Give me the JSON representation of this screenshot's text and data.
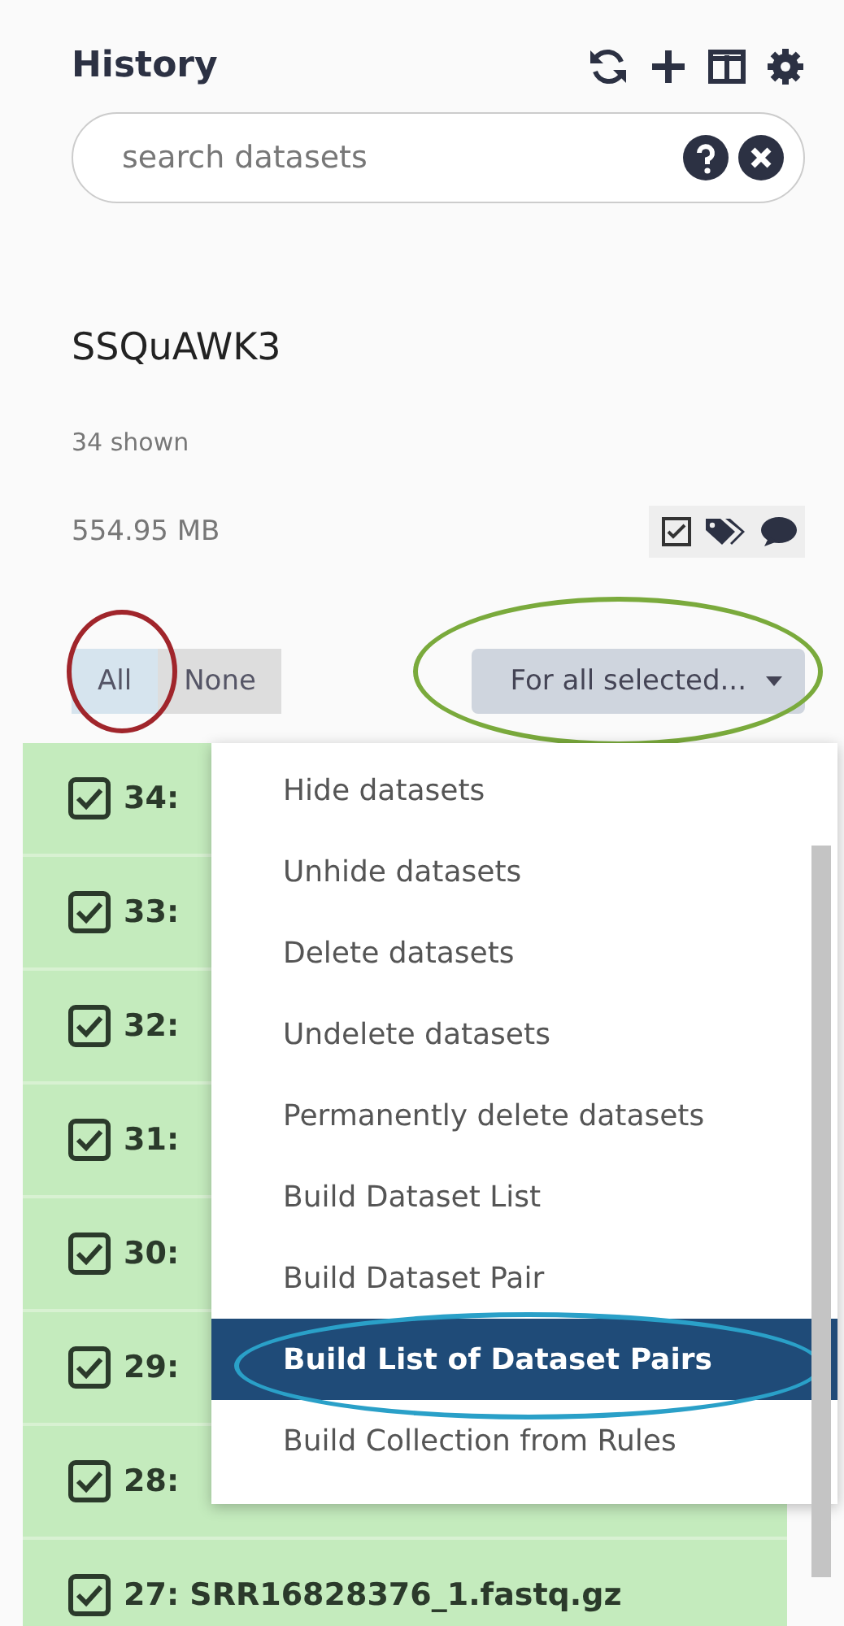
{
  "header": {
    "title": "History"
  },
  "search": {
    "placeholder": "search datasets"
  },
  "history": {
    "name": "SSQuAWK3",
    "shown": "34 shown",
    "size": "554.95 MB"
  },
  "select_buttons": [
    {
      "label": "All",
      "selected": true
    },
    {
      "label": "None",
      "selected": false
    }
  ],
  "bulk_action": {
    "label": "For all selected..."
  },
  "datasets": [
    {
      "label": "34:",
      "checked": true
    },
    {
      "label": "33:",
      "checked": true
    },
    {
      "label": "32:",
      "checked": true
    },
    {
      "label": "31:",
      "checked": true
    },
    {
      "label": "30:",
      "checked": true
    },
    {
      "label": "29:",
      "checked": true
    },
    {
      "label": "28:",
      "checked": true
    },
    {
      "label": "27: SRR16828376_1.fastq.gz",
      "checked": true
    }
  ],
  "menu": [
    {
      "label": "Hide datasets",
      "selected": false
    },
    {
      "label": "Unhide datasets",
      "selected": false
    },
    {
      "label": "Delete datasets",
      "selected": false
    },
    {
      "label": "Undelete datasets",
      "selected": false
    },
    {
      "label": "Permanently delete datasets",
      "selected": false
    },
    {
      "label": "Build Dataset List",
      "selected": false
    },
    {
      "label": "Build Dataset Pair",
      "selected": false
    },
    {
      "label": "Build List of Dataset Pairs",
      "selected": true
    },
    {
      "label": "Build Collection from Rules",
      "selected": false
    }
  ]
}
